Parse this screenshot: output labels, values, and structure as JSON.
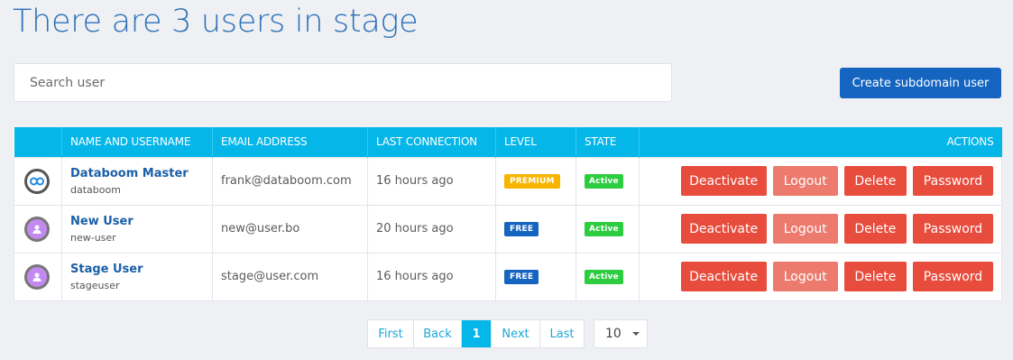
{
  "title": "There are 3 users in stage",
  "search": {
    "placeholder": "Search user"
  },
  "create_button": "Create subdomain user",
  "table": {
    "headers": [
      "",
      "NAME AND USERNAME",
      "EMAIL ADDRESS",
      "LAST CONNECTION",
      "LEVEL",
      "STATE",
      "ACTIONS"
    ],
    "rows": [
      {
        "avatar": "databoom-logo-icon",
        "name": "Databoom Master",
        "username": "databoom",
        "email": "frank@databoom.com",
        "last_connection": "16 hours ago",
        "level": "PREMIUM",
        "state": "Active"
      },
      {
        "avatar": "user-icon",
        "name": "New User",
        "username": "new-user",
        "email": "new@user.bo",
        "last_connection": "20 hours ago",
        "level": "FREE",
        "state": "Active"
      },
      {
        "avatar": "user-icon",
        "name": "Stage User",
        "username": "stageuser",
        "email": "stage@user.com",
        "last_connection": "16 hours ago",
        "level": "FREE",
        "state": "Active"
      }
    ],
    "actions": {
      "deactivate": "Deactivate",
      "logout": "Logout",
      "delete": "Delete",
      "password": "Password"
    }
  },
  "pagination": {
    "first": "First",
    "back": "Back",
    "current": "1",
    "next": "Next",
    "last": "Last"
  },
  "per_page": "10",
  "colors": {
    "header": "#05b6e8",
    "primary": "#1565c0",
    "danger": "#e74c3c",
    "premium": "#f7b500",
    "active": "#2ecc40"
  }
}
